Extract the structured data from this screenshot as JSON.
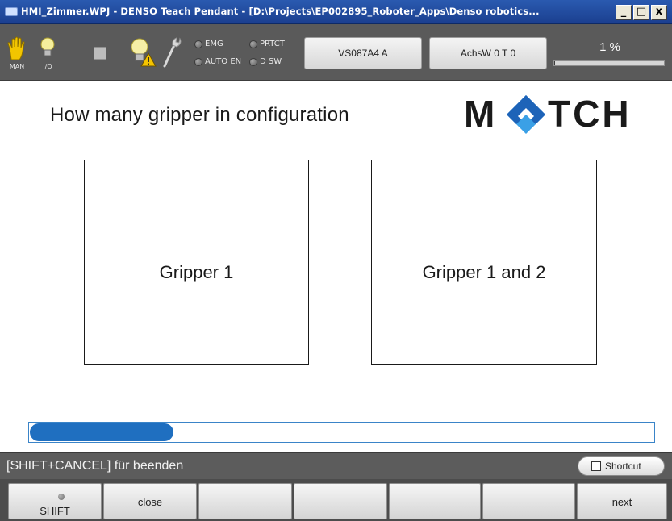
{
  "window": {
    "title": "HMI_Zimmer.WPJ - DENSO Teach Pendant - [D:\\Projects\\EP002895_Roboter_Apps\\Denso robotics...",
    "controls": {
      "minimize": "_",
      "maximize": "□",
      "close": "x"
    }
  },
  "toolbar": {
    "mode_label": "MAN",
    "io_label": "I/O",
    "icons": [
      "hand-icon",
      "io-bulb-icon",
      "stop-square-icon",
      "warning-bulb-icon",
      "wrench-icon"
    ],
    "indicators": [
      {
        "label": "EMG"
      },
      {
        "label": "PRTCT"
      },
      {
        "label": "AUTO EN"
      },
      {
        "label": "D SW"
      }
    ],
    "variable_button": "VS087A4 A",
    "axis_button": "AchsW 0 T 0",
    "speed_percent": "1 %",
    "speed_fraction": 0.01
  },
  "main": {
    "question": "How many gripper in configuration",
    "logo_text": "MATCH",
    "logo_colors": {
      "text": "#1a1a1a",
      "accent_light": "#3aa0e6",
      "accent_dark": "#1d63b8"
    },
    "choices": [
      {
        "label": "Gripper 1"
      },
      {
        "label": "Gripper 1 and 2"
      }
    ],
    "progress_fraction": 0.23,
    "progress_color": "#1f6fc0"
  },
  "statusbar": {
    "text": "[SHIFT+CANCEL] für beenden",
    "shortcut_label": "Shortcut"
  },
  "softkeys": [
    {
      "label": "SHIFT"
    },
    {
      "label": "close"
    },
    {
      "label": ""
    },
    {
      "label": ""
    },
    {
      "label": ""
    },
    {
      "label": ""
    },
    {
      "label": "next"
    }
  ]
}
